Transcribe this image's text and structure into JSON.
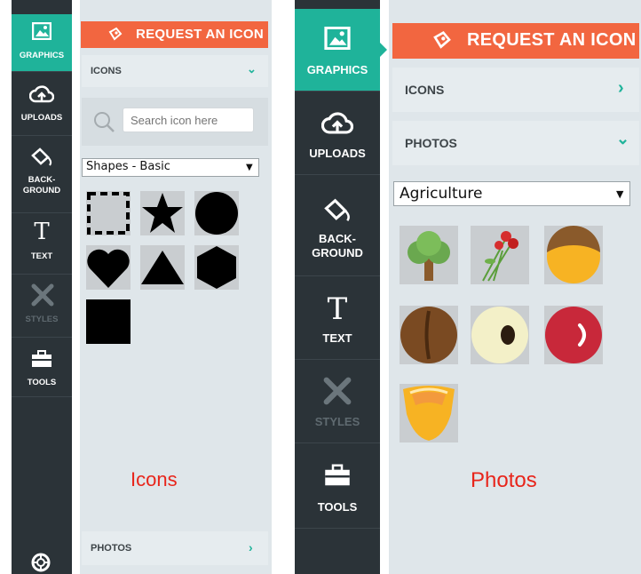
{
  "left_screen": {
    "nav": [
      {
        "label": "GRAPHICS",
        "icon": "image-icon",
        "active": true
      },
      {
        "label": "UPLOADS",
        "icon": "cloud-upload-icon"
      },
      {
        "label": "BACK-GROUND",
        "line1": "BACK-",
        "line2": "GROUND",
        "icon": "paint-bucket-icon"
      },
      {
        "label": "TEXT",
        "icon": "text-icon"
      },
      {
        "label": "STYLES",
        "icon": "styles-icon",
        "disabled": true
      },
      {
        "label": "TOOLS",
        "icon": "toolbox-icon"
      }
    ],
    "request_button": "REQUEST AN ICON",
    "icons_section": "ICONS",
    "search_placeholder": "Search icon here",
    "shape_select": "Shapes - Basic",
    "shapes": [
      "square-dashed",
      "star",
      "circle",
      "heart",
      "triangle",
      "hexagon",
      "square"
    ],
    "photos_section": "PHOTOS",
    "caption": "Icons",
    "bottom_icon": "lifebuoy-icon"
  },
  "right_screen": {
    "nav": [
      {
        "label": "GRAPHICS",
        "icon": "image-icon",
        "active": true
      },
      {
        "label": "UPLOADS",
        "icon": "cloud-upload-icon"
      },
      {
        "label": "BACK-GROUND",
        "line1": "BACK-",
        "line2": "GROUND",
        "icon": "paint-bucket-icon"
      },
      {
        "label": "TEXT",
        "icon": "text-icon"
      },
      {
        "label": "STYLES",
        "icon": "styles-icon",
        "disabled": true
      },
      {
        "label": "TOOLS",
        "icon": "toolbox-icon"
      }
    ],
    "request_button": "REQUEST AN ICON",
    "icons_section": "ICONS",
    "photos_section": "PHOTOS",
    "category_select": "Agriculture",
    "photos": [
      "tree",
      "roses",
      "onion",
      "coffee-bean",
      "egg",
      "tomato",
      "corn-slice"
    ],
    "caption": "Photos"
  },
  "colors": {
    "accent_green": "#1fb39a",
    "request_orange": "#f26640",
    "sidebar_dark": "#2b3338",
    "caption_red": "#e8251b"
  }
}
